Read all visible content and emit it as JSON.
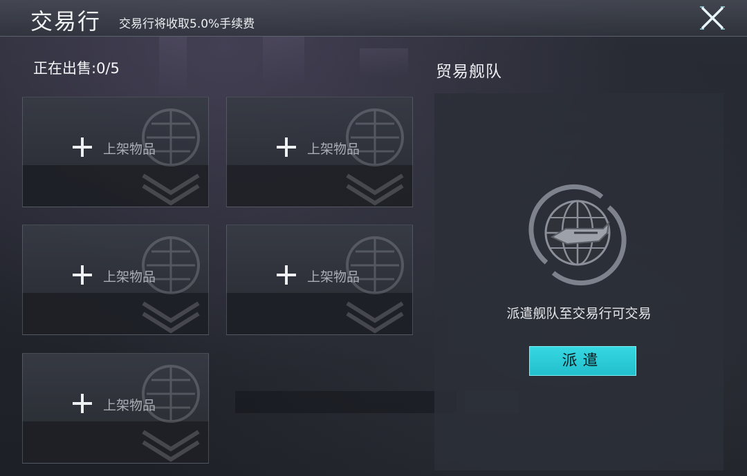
{
  "header": {
    "title": "交易行",
    "fee_note": "交易行将收取5.0%手续费"
  },
  "market": {
    "selling_status": "正在出售:0/5",
    "slots": [
      {
        "label": "上架物品"
      },
      {
        "label": "上架物品"
      },
      {
        "label": "上架物品"
      },
      {
        "label": "上架物品"
      },
      {
        "label": "上架物品"
      }
    ]
  },
  "fleet": {
    "title": "贸易舰队",
    "description": "派遣舰队至交易行可交易",
    "dispatch_label": "派遣"
  },
  "colors": {
    "accent": "#2ccdd8",
    "panel": "#2c2f37"
  },
  "icons": [
    "close-icon",
    "plus-icon",
    "globe-ship-emblem-icon"
  ]
}
